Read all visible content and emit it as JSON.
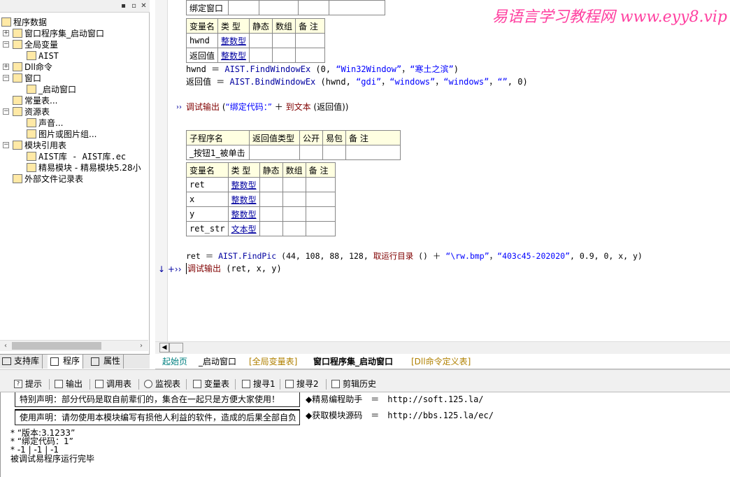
{
  "left_panel": {
    "tree": [
      {
        "label": "程序数据",
        "icon": "program-data-icon"
      },
      {
        "label": "窗口程序集_启动窗口",
        "icon": "class-module-icon"
      },
      {
        "label": "全局变量",
        "icon": "global-variable-icon"
      },
      {
        "label": "AIST",
        "icon": "variable-icon"
      },
      {
        "label": "Dll命令",
        "icon": "dll-command-icon"
      },
      {
        "label": "窗口",
        "icon": "window-icon"
      },
      {
        "label": "_启动窗口",
        "icon": "window-icon"
      },
      {
        "label": "常量表...",
        "icon": "constant-table-icon"
      },
      {
        "label": "资源表",
        "icon": "resource-table-icon"
      },
      {
        "label": "声音...",
        "icon": "sound-icon"
      },
      {
        "label": "图片或图片组...",
        "icon": "picture-icon"
      },
      {
        "label": "模块引用表",
        "icon": "module-reference-icon"
      },
      {
        "label": "AIST库 - AIST库.ec",
        "icon": "module-file-icon"
      },
      {
        "label": "精易模块 - 精易模块5.28小",
        "icon": "module-file-icon"
      },
      {
        "label": "外部文件记录表",
        "icon": "external-file-icon"
      }
    ],
    "tabs": [
      "支持库",
      "程序",
      "属性"
    ]
  },
  "code": {
    "partial_table": {
      "label": "绑定窗口"
    },
    "vartable1": {
      "headers": [
        "变量名",
        "类 型",
        "静态",
        "数组",
        "备 注"
      ],
      "rows": [
        [
          "hwnd",
          "整数型"
        ],
        [
          "返回值",
          "整数型"
        ]
      ]
    },
    "line1": {
      "lhs": "hwnd ＝ ",
      "fn": "AIST.FindWindowEx",
      "args": " (0, ",
      "s1": "“Win32Window”",
      "c": "，",
      "s2": "“寒土之滨”",
      "end": ")"
    },
    "line2": {
      "lhs": "返回值 ＝ ",
      "fn": "AIST.BindWindowEx",
      "args": " (hwnd, ",
      "s1": "“gdi”",
      "c1": "，",
      "s2": "“windows”",
      "c2": "，",
      "s3": "“windows”",
      "c3": "，",
      "s4": "“”",
      "end": ", 0)"
    },
    "line3": {
      "fn": "调试输出",
      "pre": " (",
      "s1": "“绑定代码：”",
      "mid": " ＋ ",
      "fn2": "到文本",
      "end": " (返回值))"
    },
    "subtable": {
      "headers": [
        "子程序名",
        "返回值类型",
        "公开",
        "易包",
        "备 注"
      ],
      "row": [
        "_按钮1_被单击",
        "",
        "",
        "",
        ""
      ]
    },
    "vartable2": {
      "headers": [
        "变量名",
        "类 型",
        "静态",
        "数组",
        "备 注"
      ],
      "rows": [
        [
          "ret",
          "整数型"
        ],
        [
          "x",
          "整数型"
        ],
        [
          "y",
          "整数型"
        ],
        [
          "ret_str",
          "文本型"
        ]
      ]
    },
    "line4": {
      "lhs": "ret ＝ ",
      "fn": "AIST.FindPic",
      "args": " (44, 108, 88, 128, ",
      "fn2": "取运行目录",
      "mid": " () ＋ ",
      "s1": "“\\rw.bmp”",
      "c1": "，",
      "s2": "“403c45-202020”",
      "end": ", 0.9, 0, x, y)"
    },
    "line5": {
      "fn": "调试输出",
      "end": " (ret, x, y)"
    },
    "marker_arrows": "↓ +››",
    "marker_single": "››"
  },
  "watermark": "易语言学习教程网 www.eyy8.vip",
  "code_tabs": [
    "起始页",
    "_启动窗口",
    "[全局变量表]",
    "窗口程序集_启动窗口",
    "[Dll命令定义表]"
  ],
  "bottom_tabs": [
    {
      "label": "提示",
      "icon": "tip-icon"
    },
    {
      "label": "输出",
      "icon": "output-icon"
    },
    {
      "label": "调用表",
      "icon": "call-table-icon"
    },
    {
      "label": "监视表",
      "icon": "watch-icon"
    },
    {
      "label": "变量表",
      "icon": "variable-table-icon"
    },
    {
      "label": "搜寻1",
      "icon": "search1-icon"
    },
    {
      "label": "搜寻2",
      "icon": "search2-icon"
    },
    {
      "label": "剪辑历史",
      "icon": "clipboard-history-icon"
    }
  ],
  "output": {
    "notice1": "特别声明：部分代码是取自前辈们的，集合在一起只是方便大家使用！",
    "notice2": "使用声明：请勿使用本模块编写有损他人利益的软件，造成的后果全部自负",
    "helper_label": "◆精易编程助手",
    "helper_eq": "＝",
    "helper_url": "http://soft.125.la/",
    "source_label": "◆获取模块源码",
    "source_eq": "＝",
    "source_url": "http://bbs.125.la/ec/",
    "lines": [
      "* “版本:3.1233”",
      "* “绑定代码：1”",
      "* -1 | -1 | -1",
      "被调试易程序运行完毕"
    ]
  },
  "colors": {
    "keyword": "#800000",
    "string": "#0000ff",
    "function": "#0000a0",
    "watermark": "#ff40a0",
    "table_header": "#ffffe1"
  }
}
